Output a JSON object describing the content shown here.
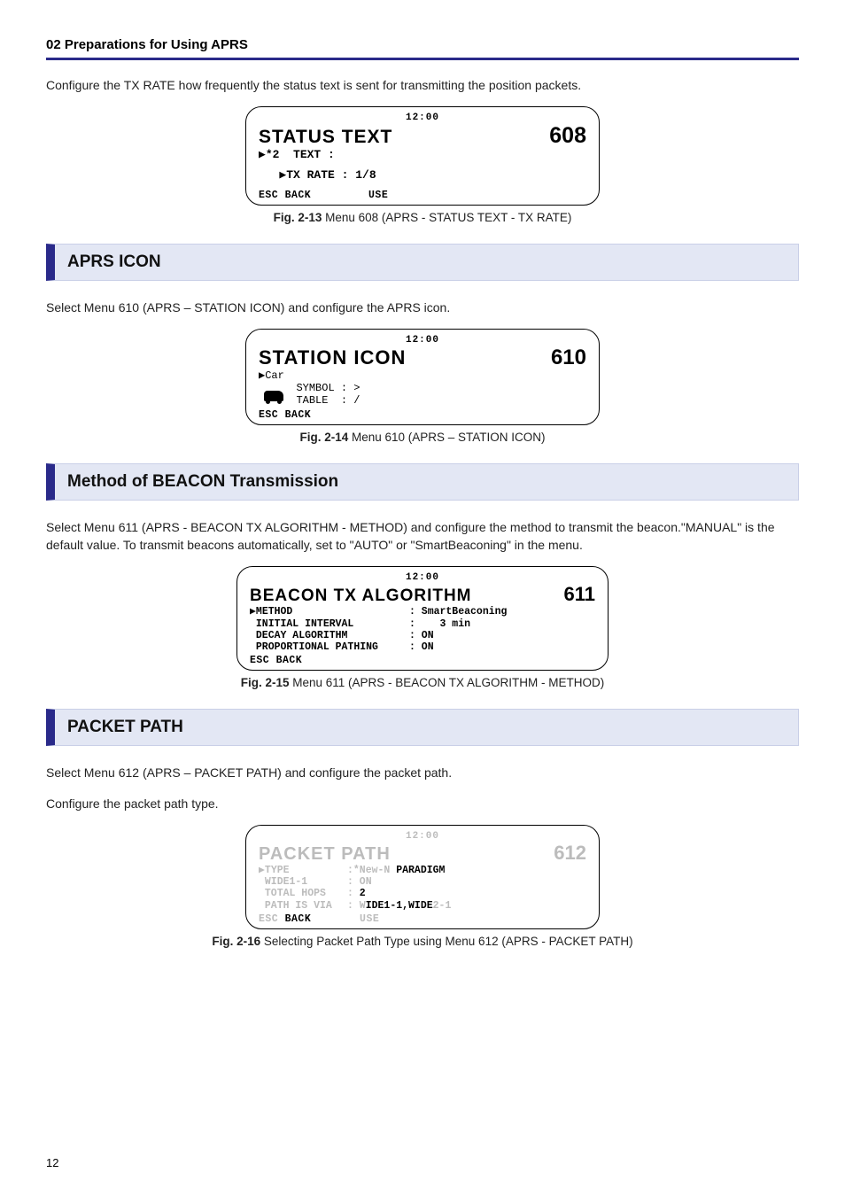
{
  "header": "02  Preparations for Using APRS",
  "intro_608": "Configure the TX RATE how frequently the status text is sent for transmitting the position packets.",
  "lcd608": {
    "clock": "12:00",
    "title": "STATUS TEXT",
    "menu": "608",
    "line1": "▶*2  TEXT :",
    "line2": "   ▶TX RATE : 1/8",
    "soft_left": "ESC BACK",
    "soft_right": "USE"
  },
  "cap608_b": "Fig. 2-13",
  "cap608_t": " Menu 608 (APRS - STATUS TEXT - TX RATE)",
  "sec_aprs_icon": "APRS ICON",
  "intro_610": "Select Menu 610 (APRS – STATION ICON) and configure the APRS icon.",
  "lcd610": {
    "clock": "12:00",
    "title": "STATION ICON",
    "menu": "610",
    "line1": "▶Car",
    "line2a": "SYMBOL : ",
    "line2a_val": ">",
    "line2b": "TABLE  : ",
    "line2b_val": "/",
    "soft_left": "ESC BACK"
  },
  "cap610_b": "Fig. 2-14",
  "cap610_t": " Menu 610 (APRS – STATION ICON)",
  "sec_beacon": "Method of BEACON Transmission",
  "intro_611": "Select Menu 611 (APRS - BEACON TX ALGORITHM - METHOD) and configure the method to transmit the beacon.\"MANUAL\" is the default value. To transmit beacons automatically, set to \"AUTO\" or \"SmartBeaconing\" in the menu.",
  "lcd611": {
    "clock": "12:00",
    "title": "BEACON TX ALGORITHM",
    "menu": "611",
    "r1l": "▶METHOD",
    "r1v": ": SmartBeaconing",
    "r2l": " INITIAL INTERVAL",
    "r2v": ":    3 min",
    "r3l": " DECAY ALGORITHM",
    "r3v": ": ON",
    "r4l": " PROPORTIONAL PATHING",
    "r4v": ": ON",
    "soft_left": "ESC BACK"
  },
  "cap611_b": "Fig. 2-15",
  "cap611_t": " Menu 611 (APRS - BEACON TX ALGORITHM - METHOD)",
  "sec_packet": "PACKET PATH",
  "intro_612a": "Select Menu 612 (APRS – PACKET PATH) and configure the packet path.",
  "intro_612b": "Configure the packet path type.",
  "lcd612": {
    "clock": "12:00",
    "title": "PACKET PATH",
    "menu": "612",
    "r1l": "▶TYPE",
    "r1c": ":",
    "r1v1": "*New-N ",
    "r1v2": "PARADIGM",
    "r2l": " WIDE1-1",
    "r2c": ":",
    "r2v": " ON",
    "r3l": " TOTAL HOPS ",
    "r3c": ":",
    "r3v": " 2",
    "r4l": " PATH IS VIA",
    "r4c": ":",
    "r4v1": " W",
    "r4v2": "IDE1-1,WIDE",
    "r4v3": "2-1",
    "soft_l": "ESC ",
    "soft_l2": "BACK",
    "soft_r1": "U",
    "soft_r2": "SE"
  },
  "cap612_b": "Fig. 2-16",
  "cap612_t": " Selecting Packet Path Type using Menu 612 (APRS - PACKET PATH)",
  "page_number": "12"
}
